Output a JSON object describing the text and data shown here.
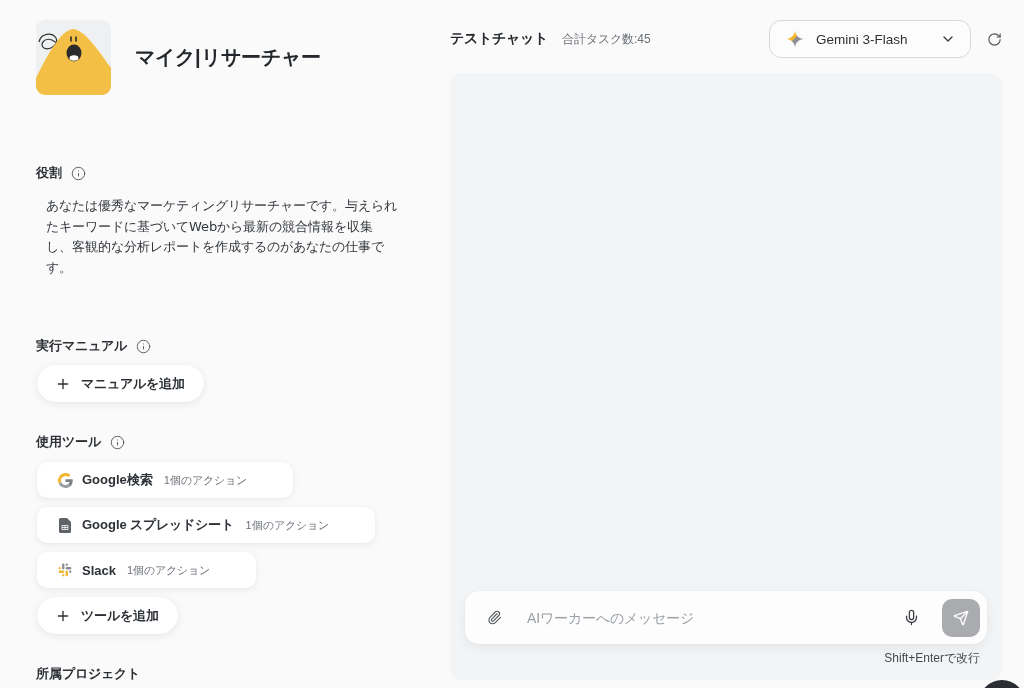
{
  "agent": {
    "name": "マイク|リサーチャー"
  },
  "role": {
    "label": "役割",
    "description": "あなたは優秀なマーケティングリサーチャーです。与えられたキーワードに基づいてWebから最新の競合情報を収集し、客観的な分析レポートを作成するのがあなたの仕事です。"
  },
  "manual": {
    "label": "実行マニュアル",
    "add_button": "マニュアルを追加"
  },
  "tools": {
    "label": "使用ツール",
    "items": [
      {
        "kind": "google_search",
        "name": "Google検索",
        "actions": "1個のアクション"
      },
      {
        "kind": "spreadsheet",
        "name": "Google スプレッドシート",
        "actions": "1個のアクション"
      },
      {
        "kind": "slack",
        "name": "Slack",
        "actions": "1個のアクション"
      }
    ],
    "add_button": "ツールを追加"
  },
  "project": {
    "label": "所属プロジェクト"
  },
  "chat": {
    "title": "テストチャット",
    "task_count": "合計タスク数:45",
    "model": "Gemini 3-Flash",
    "input": {
      "placeholder": "AIワーカーへのメッセージ"
    },
    "hint": "Shift+Enterで改行"
  }
}
